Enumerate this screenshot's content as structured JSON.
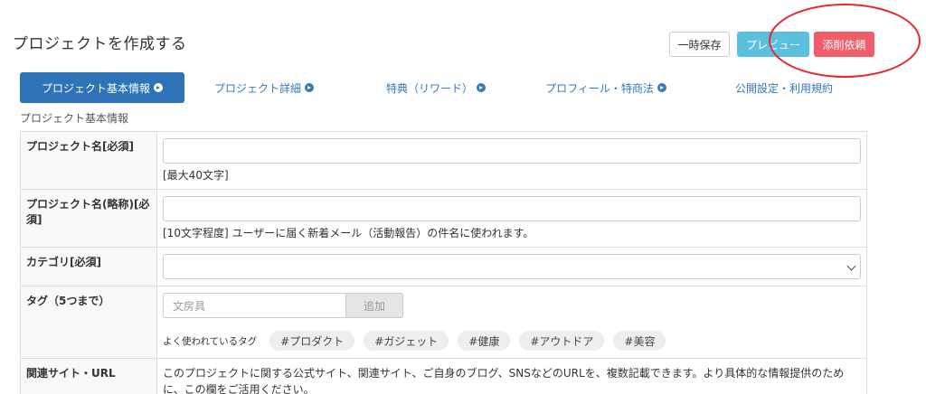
{
  "header": {
    "title": "プロジェクトを作成する",
    "save_label": "一時保存",
    "preview_label": "プレビュー",
    "review_label": "添削依頼"
  },
  "tabs": [
    {
      "label": "プロジェクト基本情報",
      "active": true
    },
    {
      "label": "プロジェクト詳細",
      "active": false
    },
    {
      "label": "特典（リワード）",
      "active": false
    },
    {
      "label": "プロフィール・特商法",
      "active": false
    },
    {
      "label": "公開設定・利用規約",
      "active": false
    }
  ],
  "section": {
    "title": "プロジェクト基本情報"
  },
  "form": {
    "name_label": "プロジェクト名[必須]",
    "name_value": "",
    "name_note": "[最大40文字]",
    "short_label": "プロジェクト名(略称)[必須]",
    "short_value": "",
    "short_note": "[10文字程度] ユーザーに届く新着メール（活動報告）の件名に使われます。",
    "category_label": "カテゴリ[必須]",
    "category_value": "",
    "tag_label": "タグ（5つまで）",
    "tag_placeholder": "文房具",
    "tag_add_label": "追加",
    "popular_label": "よく使われているタグ",
    "popular_tags": [
      "#プロダクト",
      "#ガジェット",
      "#健康",
      "#アウトドア",
      "#美容"
    ],
    "url_label": "関連サイト・URL",
    "url_description": "このプロジェクトに関する公式サイト、関連サイト、ご自身のブログ、SNSなどのURLを、複数記載できます。より具体的な情報提供のために、この欄をご活用ください。"
  },
  "colors": {
    "primary_tab": "#2e73b8",
    "preview": "#5bc0de",
    "review": "#f05d6a",
    "annotation_circle": "#e8262c"
  }
}
